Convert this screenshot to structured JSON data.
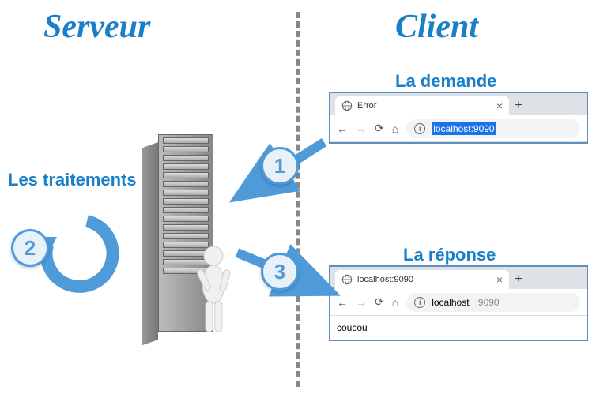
{
  "headings": {
    "server": "Serveur",
    "client": "Client"
  },
  "labels": {
    "request": "La demande",
    "processing": "Les traitements",
    "response": "La réponse"
  },
  "steps": {
    "s1": "1",
    "s2": "2",
    "s3": "3"
  },
  "browser_request": {
    "tab_title": "Error",
    "url_host": "localhost:9090",
    "selected": true,
    "body": ""
  },
  "browser_response": {
    "tab_title": "localhost:9090",
    "url_host": "localhost",
    "url_port": ":9090",
    "selected": false,
    "body": "coucou"
  },
  "colors": {
    "accent": "#1a7fc9",
    "arrow": "#4f9bd9"
  }
}
